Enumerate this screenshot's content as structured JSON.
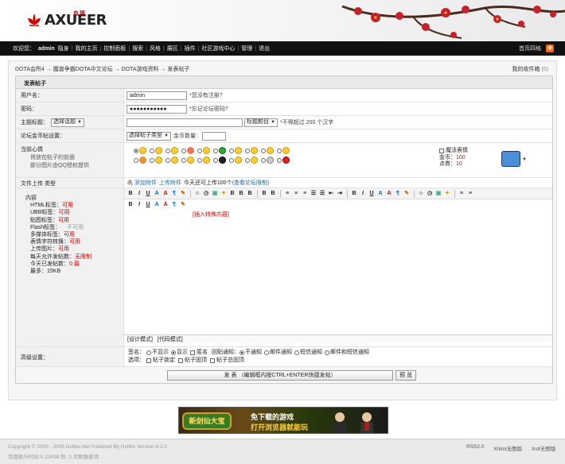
{
  "header": {
    "logo_text": "AXUEER",
    "logo_sub": "血瑶"
  },
  "navbar": {
    "welcome": "欢迎您：",
    "user": "admin",
    "items": [
      "隐身",
      "我的主页",
      "控制面板",
      "搜索",
      "风格",
      "展区",
      "插件",
      "社区游戏中心",
      "管理",
      "退出"
    ],
    "right_label": "首页四格"
  },
  "breadcrumb": {
    "items": [
      "DOTA会所4",
      "魔兽争霸DOTA中文论坛",
      "DOTA游戏资料",
      "发表帖子"
    ],
    "inbox_label": "我的收件箱",
    "inbox_count": "(0)"
  },
  "form": {
    "title": "发表帖子",
    "username": {
      "label": "用户名：",
      "value": "admin",
      "hint": "*您没有注册?"
    },
    "password": {
      "label": "密码：",
      "value": "●●●●●●●●●●●",
      "hint": "*忘记论坛密码?"
    },
    "subject": {
      "label": "主题标题：",
      "topic_select": "选择话题",
      "color_select": "标题颜目",
      "hint": "*不得超过 200 个汉字"
    },
    "pay": {
      "label": "论坛金币帖设置：",
      "type_select": "选择帖子类型",
      "coins_label": "金币数量："
    },
    "mood": {
      "label": "当前心情",
      "sub1": "将放在帖子的前面",
      "sub2": "部分图片由QQ授权提供",
      "magic_label": "魔法表情",
      "gold_label": "金币：",
      "gold_value": "100",
      "points_label": "点券：",
      "points_value": "10"
    },
    "upload": {
      "label": "文件上传 类型",
      "add_link": "添加附件",
      "upload_link": "上传附件",
      "today_text": "今天还可上传100个",
      "limit_link": "(查看论坛限制)"
    },
    "content": {
      "label": "内容",
      "settings": [
        {
          "name": "HTML标签：",
          "value": "可用"
        },
        {
          "name": "UBB标签：",
          "value": "可用"
        },
        {
          "name": "贴图标签：",
          "value": "可用"
        },
        {
          "name": "Flash标签：",
          "value": "不可用"
        },
        {
          "name": "多媒体标签：",
          "value": "可用"
        },
        {
          "name": "表情字符转换：",
          "value": "可用"
        },
        {
          "name": "上传图片：",
          "value": "可用"
        },
        {
          "name": "每天允许发帖数：",
          "value": "无限制"
        },
        {
          "name": "今天已发帖数：",
          "value": "0 篇"
        },
        {
          "name": "最多：",
          "value": "15KB"
        }
      ],
      "special_label": "[插入特殊内容]",
      "design_mode": "[设计模式]",
      "code_mode": "[代码模式]"
    },
    "advanced": {
      "label": "高级设置：",
      "sign_label": "签名：",
      "sign_options": [
        "不显示",
        "显示",
        "匿名"
      ],
      "notify_label": "回贴通知：",
      "notify_options": [
        "不通知",
        "邮件通知",
        "短信通知",
        "邮件和短信通知"
      ],
      "options_label": "选项：",
      "options": [
        "帖子锁定",
        "帖子固顶",
        "帖子总固顶"
      ]
    },
    "submit_label": "发 表 （编辑框内按CTRL+ENTER快捷发帖）",
    "preview_label": "预 览"
  },
  "banner": {
    "logo": "新剑仙大宝",
    "line1": "免下载的游戏",
    "line2": "打开浏览器就能玩"
  },
  "footer": {
    "copyright": "Copyright © 2000 - 2006 Dvbbs.Net  Powered By Dvbbs Version 8.2.0",
    "exec_time": "页面执行时间 0.23438 秒, 3 次数据查询",
    "rss": "RSS2.0",
    "xhtml": "Xhtml无图版",
    "xslt": "Xslt无图版"
  }
}
